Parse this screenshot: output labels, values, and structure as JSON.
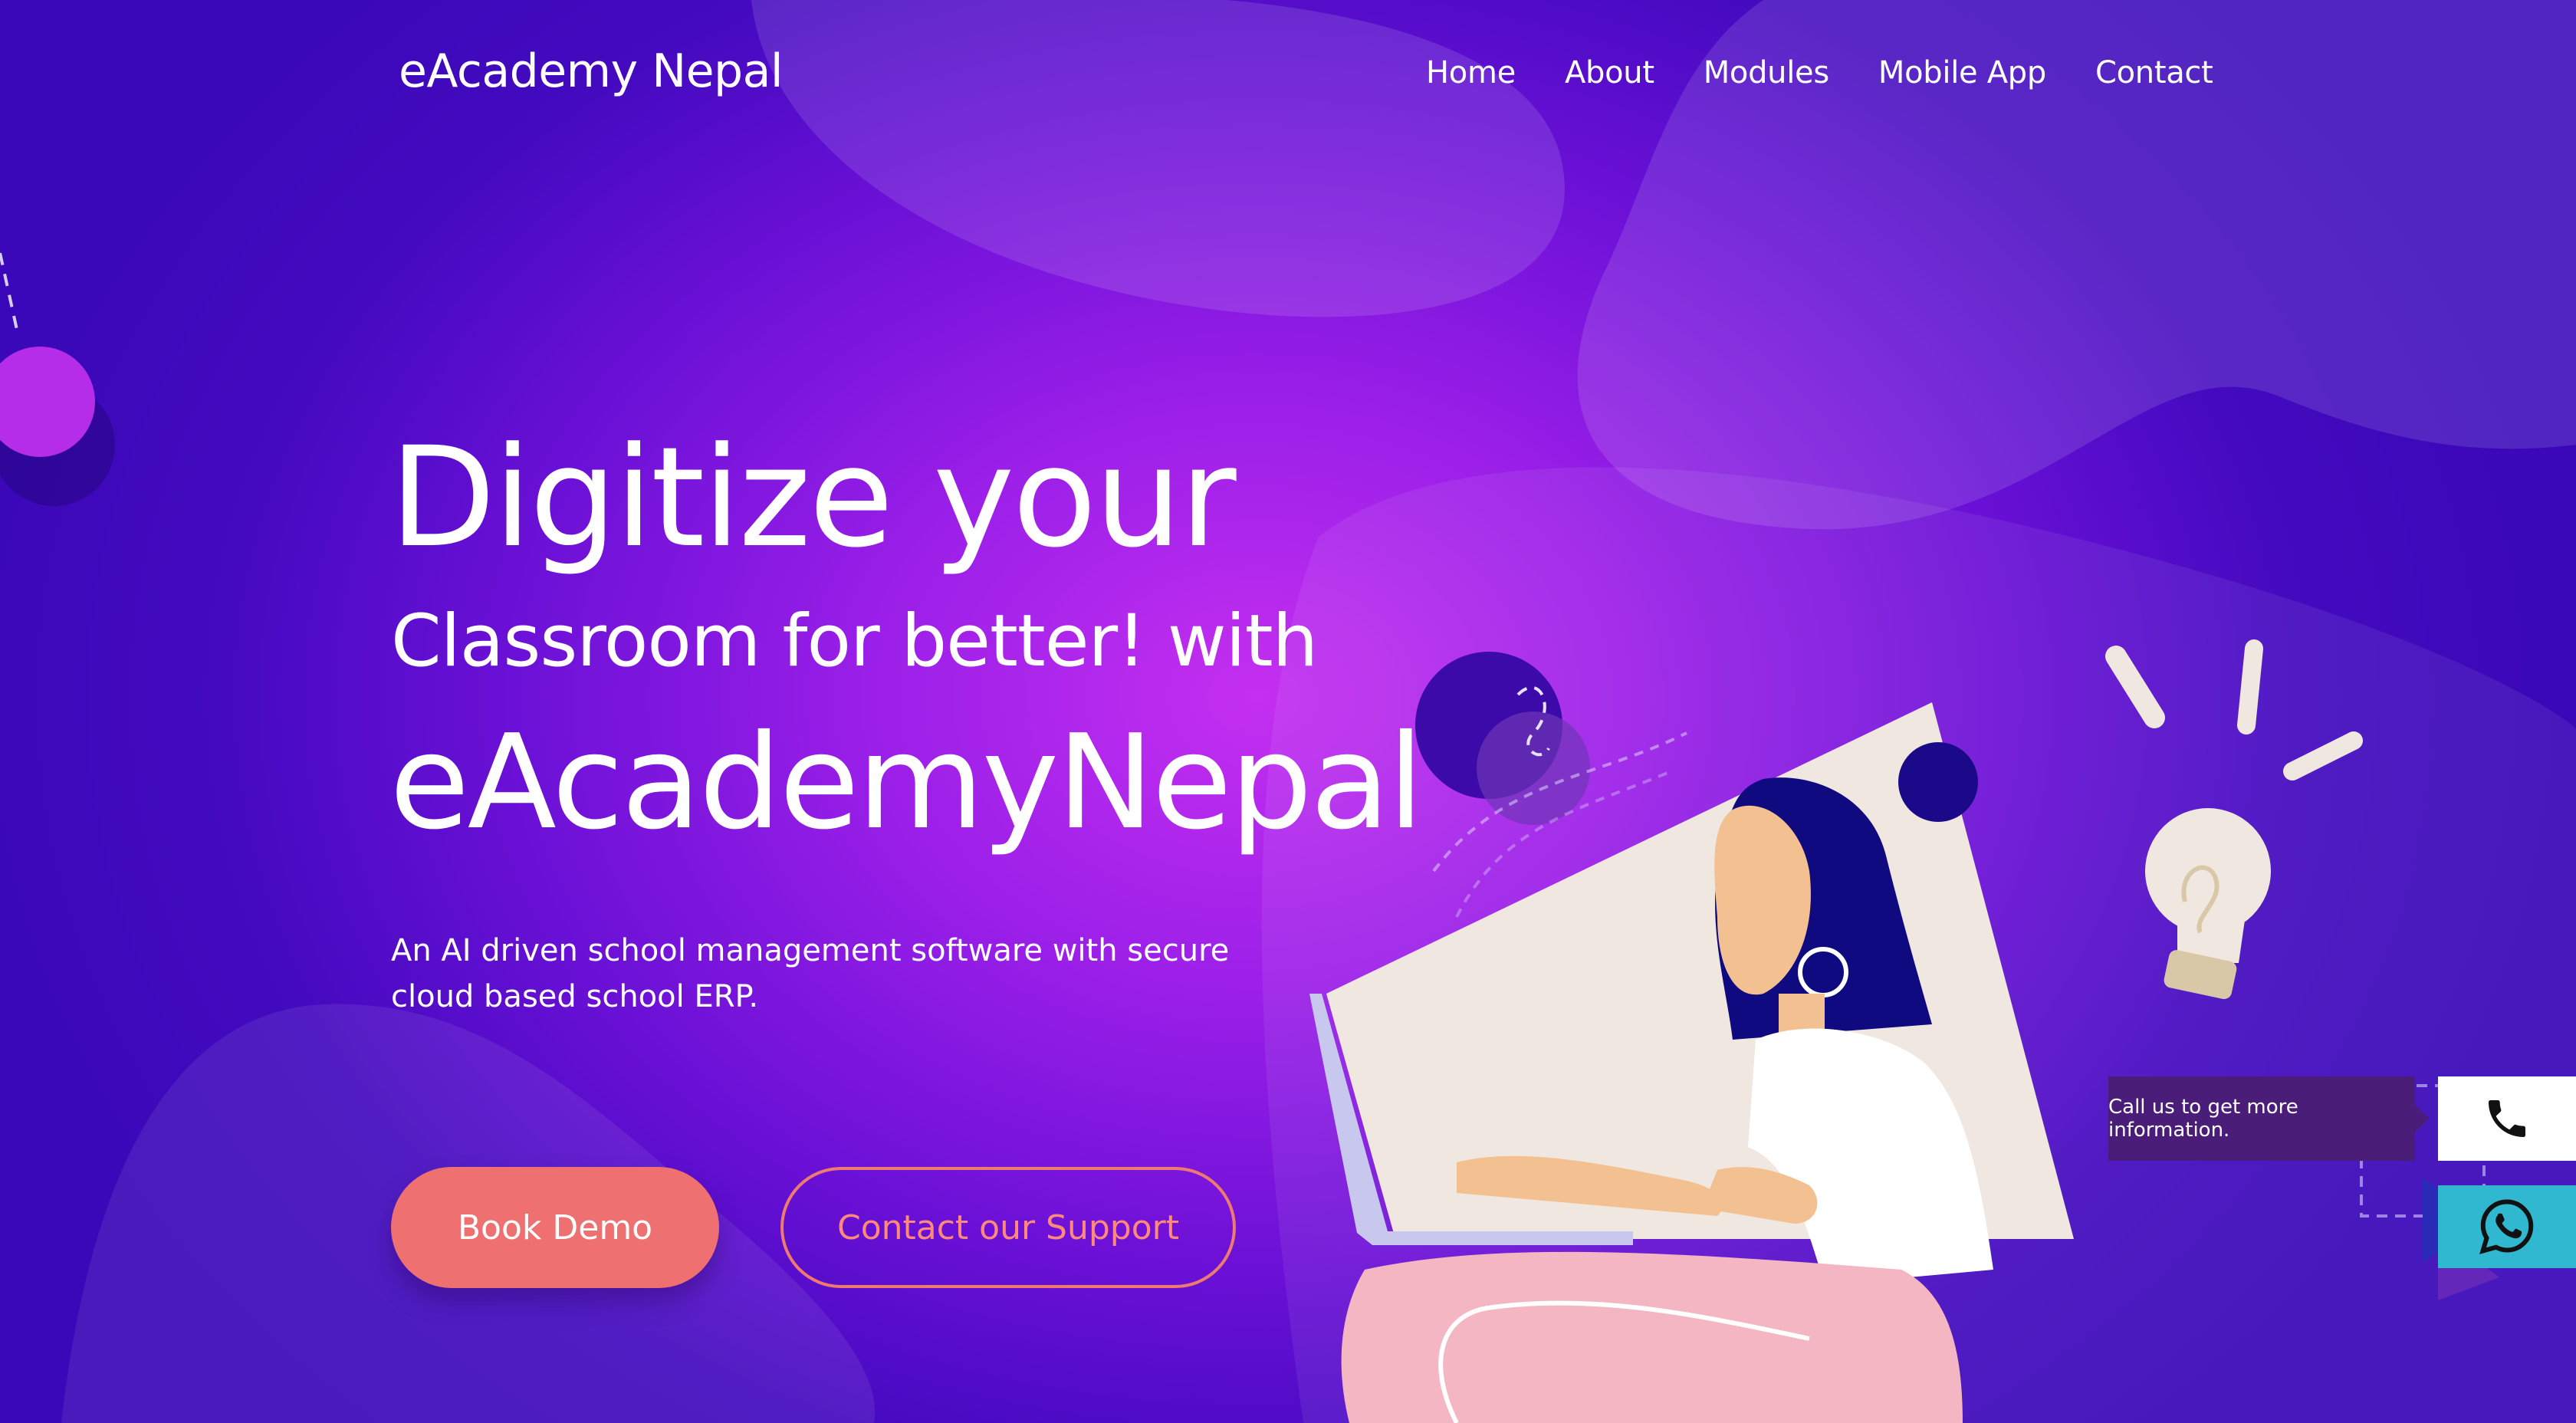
{
  "header": {
    "logo": "eAcademy Nepal",
    "nav": [
      {
        "label": "Home"
      },
      {
        "label": "About"
      },
      {
        "label": "Modules"
      },
      {
        "label": "Mobile App"
      },
      {
        "label": "Contact"
      }
    ]
  },
  "hero": {
    "line1": "Digitize your",
    "line2": "Classroom for better! with",
    "line3": "eAcademyNepal",
    "subtitle": "An AI driven school management software with secure cloud based school ERP.",
    "buttons": {
      "book_demo": "Book Demo",
      "contact_support": "Contact our Support"
    }
  },
  "floating": {
    "call_tooltip": "Call us to get more information.",
    "call_icon": "phone-icon",
    "whatsapp_icon": "whatsapp-icon"
  },
  "colors": {
    "primary_button": "#ef7070",
    "whatsapp": "#2fb8d0",
    "background_dark": "#3a08b8",
    "background_glow": "#c42ff0"
  }
}
